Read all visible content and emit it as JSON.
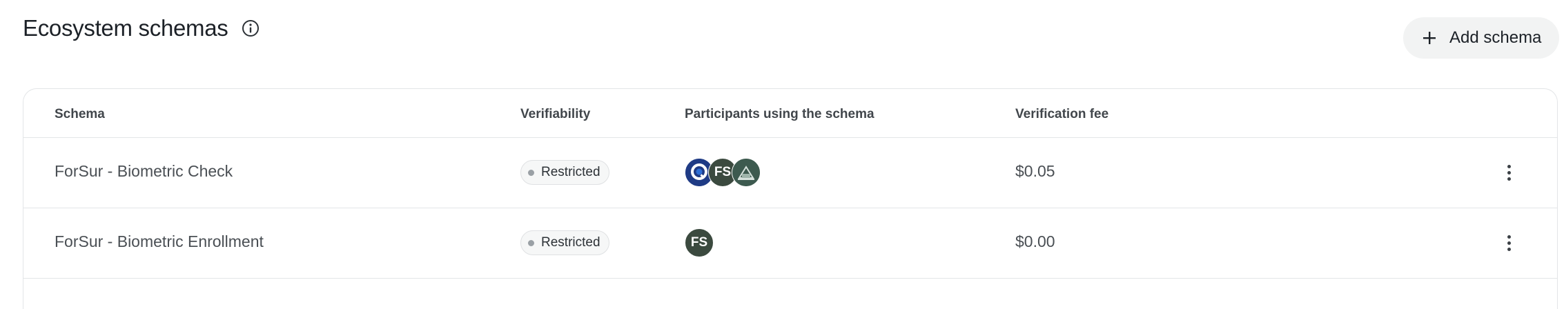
{
  "header": {
    "title": "Ecosystem schemas",
    "info_icon": "info-circle-icon",
    "add_button_label": "Add schema",
    "add_button_icon": "plus-icon"
  },
  "table": {
    "columns": [
      "Schema",
      "Verifiability",
      "Participants using the schema",
      "Verification fee"
    ],
    "rows": [
      {
        "schema": "ForSur - Biometric Check",
        "verifiability": "Restricted",
        "participants": [
          {
            "icon": "q-logo-avatar",
            "label": "Q",
            "color": "#1f3b85"
          },
          {
            "icon": "fs-logo-avatar",
            "label": "FS",
            "color": "#3b4a3f"
          },
          {
            "icon": "building-logo-avatar",
            "label": "",
            "color": "#3d5a4f"
          }
        ],
        "fee": "$0.05"
      },
      {
        "schema": "ForSur - Biometric Enrollment",
        "verifiability": "Restricted",
        "participants": [
          {
            "icon": "fs-logo-avatar",
            "label": "FS",
            "color": "#3b4a3f"
          }
        ],
        "fee": "$0.00"
      }
    ]
  },
  "colors": {
    "border": "#e3e5e7",
    "button_bg": "#f2f3f3",
    "badge_dot": "#9aa0a5"
  }
}
